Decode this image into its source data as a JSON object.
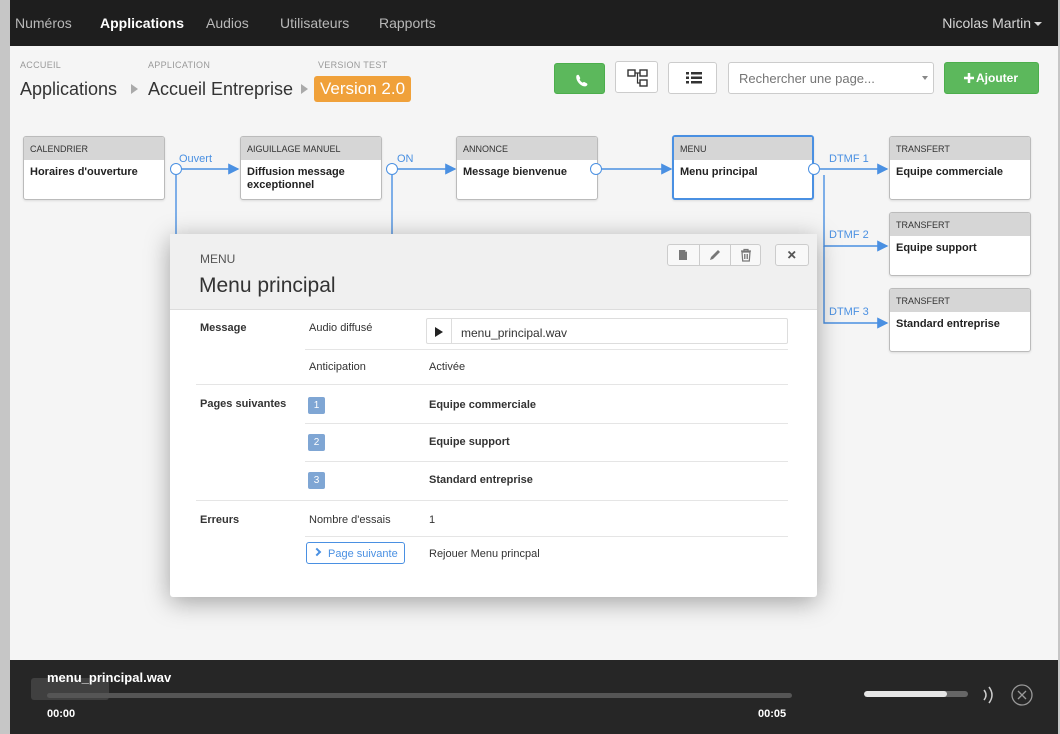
{
  "nav": {
    "items": [
      {
        "label": "Numéros",
        "active": false
      },
      {
        "label": "Applications",
        "active": true
      },
      {
        "label": "Audios",
        "active": false
      },
      {
        "label": "Utilisateurs",
        "active": false
      },
      {
        "label": "Rapports",
        "active": false
      }
    ],
    "user": "Nicolas Martin"
  },
  "breadcrumb": {
    "items": [
      {
        "small": "ACCUEIL",
        "label": "Applications"
      },
      {
        "small": "APPLICATION",
        "label": "Accueil Entreprise"
      },
      {
        "small": "VERSION TEST",
        "label": "Version 2.0"
      }
    ]
  },
  "toolbar": {
    "search_placeholder": "Rechercher une page...",
    "add_label": "Ajouter",
    "icons": [
      "phone-icon",
      "flowchart-icon",
      "list-icon"
    ]
  },
  "flow": {
    "nodes": [
      {
        "type": "CALENDRIER",
        "title": "Horaires d'ouverture"
      },
      {
        "type": "AIGUILLAGE MANUEL",
        "title": "Diffusion message exceptionnel"
      },
      {
        "type": "ANNONCE",
        "title": "Message bienvenue"
      },
      {
        "type": "MENU",
        "title": "Menu principal"
      },
      {
        "type": "TRANSFERT",
        "title": "Equipe commerciale"
      },
      {
        "type": "TRANSFERT",
        "title": "Equipe support"
      },
      {
        "type": "TRANSFERT",
        "title": "Standard entreprise"
      }
    ],
    "edges": [
      "Ouvert",
      "ON",
      "DTMF 1",
      "DTMF 2",
      "DTMF 3"
    ]
  },
  "modal": {
    "type": "MENU",
    "title": "Menu principal",
    "sections": {
      "message": "Message",
      "pages": "Pages suivantes",
      "errors": "Erreurs"
    },
    "audio_label": "Audio diffusé",
    "audio_file": "menu_principal.wav",
    "anticipation_label": "Anticipation",
    "anticipation_value": "Activée",
    "next_pages": [
      {
        "num": "1",
        "label": "Equipe commerciale"
      },
      {
        "num": "2",
        "label": "Equipe support"
      },
      {
        "num": "3",
        "label": "Standard entreprise"
      }
    ],
    "tries_label": "Nombre d'essais",
    "tries_value": "1",
    "next_page_button": "Page suivante",
    "next_page_value": "Rejouer Menu princpal"
  },
  "player": {
    "file": "menu_principal.wav",
    "current": "00:00",
    "duration": "00:05",
    "progress": 0,
    "volume": 0.8
  }
}
